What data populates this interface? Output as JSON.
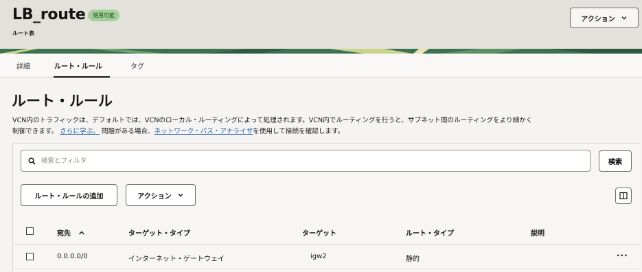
{
  "header": {
    "title": "LB_route",
    "status": "使用可能",
    "subtitle": "ルート表",
    "actions_label": "アクション"
  },
  "tabs": [
    {
      "label": "詳細",
      "active": false
    },
    {
      "label": "ルート・ルール",
      "active": true
    },
    {
      "label": "タグ",
      "active": false
    }
  ],
  "main": {
    "title": "ルート・ルール",
    "desc_line1": "VCN内のトラフィックは、デフォルトでは、VCNのローカル・ルーティングによって処理されます。VCN内でルーティングを行うと、サブネット間のルーティングをより細かく",
    "desc_line2_pre": "制御できます。",
    "learn_more": "さらに学ぶ。",
    "desc_line2_mid": "問題がある場合、",
    "analyzer_link": "ネットワーク・パス・アナライザ",
    "desc_line2_post": "を使用して接続を確認します。"
  },
  "toolbar": {
    "search_placeholder": "検索とフィルタ",
    "search_button": "検索",
    "add_rule_button": "ルート・ルールの追加",
    "actions_button": "アクション"
  },
  "table": {
    "columns": [
      "宛先",
      "ターゲット・タイプ",
      "ターゲット",
      "ルート・タイプ",
      "説明"
    ],
    "rows": [
      {
        "destination": "0.0.0.0/0",
        "target_type": "インターネット・ゲートウェイ",
        "target": "igw2",
        "route_type": "静的",
        "description": ""
      }
    ],
    "row_menu": "···"
  },
  "colors": {
    "header_bg": "#e4e1dc",
    "badge_bg": "#a4cf9a",
    "link": "#1f5fa8"
  }
}
